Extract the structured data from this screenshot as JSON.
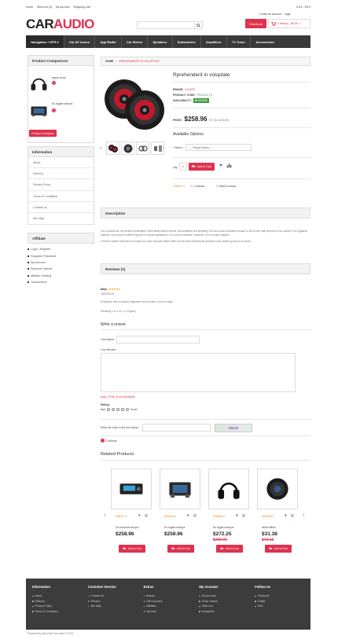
{
  "topbar": {
    "links": [
      "Home",
      "Wish List (0)",
      "My Account",
      "Shopping Cart"
    ],
    "right_currency": "£ $ €",
    "right_lang": "EN ▾",
    "create_account": "Create an account",
    "login": "Login"
  },
  "logo": {
    "part1": "CAR",
    "part2": "AUDIO"
  },
  "search": {
    "placeholder": ""
  },
  "checkout_label": "Checkout",
  "cart_label": "0 item(s) - $0.00",
  "nav": [
    "Navigation / GPS ▾",
    "Car AV tuners",
    "App Radio",
    "Car Stereo",
    "Speakers",
    "Subwoofers",
    "Amplifiers",
    "TV Tuner",
    "Accessories"
  ],
  "breadcrumb": {
    "home": "HOME",
    "current": "RPREHENDERIT IN VOLUPTATE"
  },
  "compare": {
    "title": "Product Comparison",
    "items": [
      "Ipsum dolor",
      "Eu fugiat nulla pa"
    ],
    "button": "Product Compare"
  },
  "info_menu": {
    "title": "Information",
    "items": [
      "About",
      "Delivery",
      "Privacy Policy",
      "Terms & Conditions",
      "Contact Us",
      "Site Map"
    ]
  },
  "affiliate": {
    "title": "Affiliate",
    "items": [
      "Login / Register",
      "Forgotten Password",
      "My Account",
      "Payment Options",
      "Affiliate Tracking",
      "Transactions"
    ]
  },
  "product": {
    "name": "Rprehenderit in voluptate",
    "brand_label": "BRAND:",
    "brand_value": "KICKER",
    "code_label": "PRODUCT CODE:",
    "code_value": "PRODUCT 6",
    "avail_label": "AVAILABILITY:",
    "avail_value": "IN STOCK",
    "price_label": "PRICE:",
    "price": "$258.96",
    "ex_tax": "Ex Tax: $258.96",
    "options_title": "Available Options",
    "select_label": "* Select:",
    "select_value": "--- Please Select ---",
    "qty_label": "Qty:",
    "qty_value": "1",
    "add_to_cart": "Add to Cart",
    "rating": 3,
    "reviews_link": "1 reviews",
    "write_review_link": "Write a review"
  },
  "description": {
    "title": "Description",
    "p1": "Our products are the perfect combination of the latest fashion trends, real durability and flexibility. You know that nowadays release is one of the main spheres of our society. It is a gigantic machine of production different goods for mental satisfaction. It is a real investment. However, it is a modern subject.",
    "p2": "It doesn't matter what kind of a buyer you were because tastes differ but we have collected all possible music-related goods in our store."
  },
  "reviews": {
    "title": "Reviews (1)",
    "author": "Mary",
    "rating": 4,
    "date": "18/02/2014",
    "text": "Excepteur sint occaecat vulputate non proident, sunt in culpa.",
    "showing": "Showing 1 to 1 of 1 (1 Pages)"
  },
  "write_review": {
    "title": "Write a review",
    "name_label": "Your Name:",
    "review_label": "Your Review:",
    "note": "Note: HTML is not translated!",
    "rating_label": "Rating:",
    "bad": "Bad",
    "good": "Good",
    "captcha_label": "Enter the code in the box below:",
    "captcha_code": "55c20",
    "continue": "Continue"
  },
  "related": {
    "title": "Related Products",
    "items": [
      {
        "name": "Oo eiusmod tempor",
        "price": "$258.96",
        "old": "",
        "rating": 3,
        "kind": "radio"
      },
      {
        "name": "Eu fugiat nulla pa",
        "price": "$258.96",
        "old": "",
        "rating": 4,
        "kind": "amp"
      },
      {
        "name": "Eu fugiat nulla pa",
        "price": "$272.25",
        "old": "$295.00",
        "rating": 4,
        "kind": "head"
      },
      {
        "name": "Nulla fuffaci",
        "price": "$31.38",
        "old": "$43.13",
        "rating": 4,
        "kind": "sub"
      }
    ],
    "add_label": "Add to Cart"
  },
  "footer": {
    "cols": [
      {
        "title": "Information",
        "items": [
          "About",
          "Delivery",
          "Privacy Policy",
          "Terms & Conditions"
        ]
      },
      {
        "title": "Customer Service",
        "items": [
          "Contact Us",
          "Returns",
          "Site Map"
        ]
      },
      {
        "title": "Extras",
        "items": [
          "Brands",
          "Gift Vouchers",
          "Affiliates",
          "Specials"
        ]
      },
      {
        "title": "My Account",
        "items": [
          "My Account",
          "Order History",
          "Wish List",
          "Newsletter"
        ]
      },
      {
        "title": "Follow Us",
        "items": [
          "Facebook",
          "Twitter",
          "RSS"
        ]
      }
    ],
    "copyright": "Powered By OpenCart Car Audio © 2014"
  },
  "colors": {
    "accent": "#e0314e",
    "nav": "#3a3a3a",
    "footer": "#3c3c3c",
    "stock": "#3a9a3a"
  }
}
